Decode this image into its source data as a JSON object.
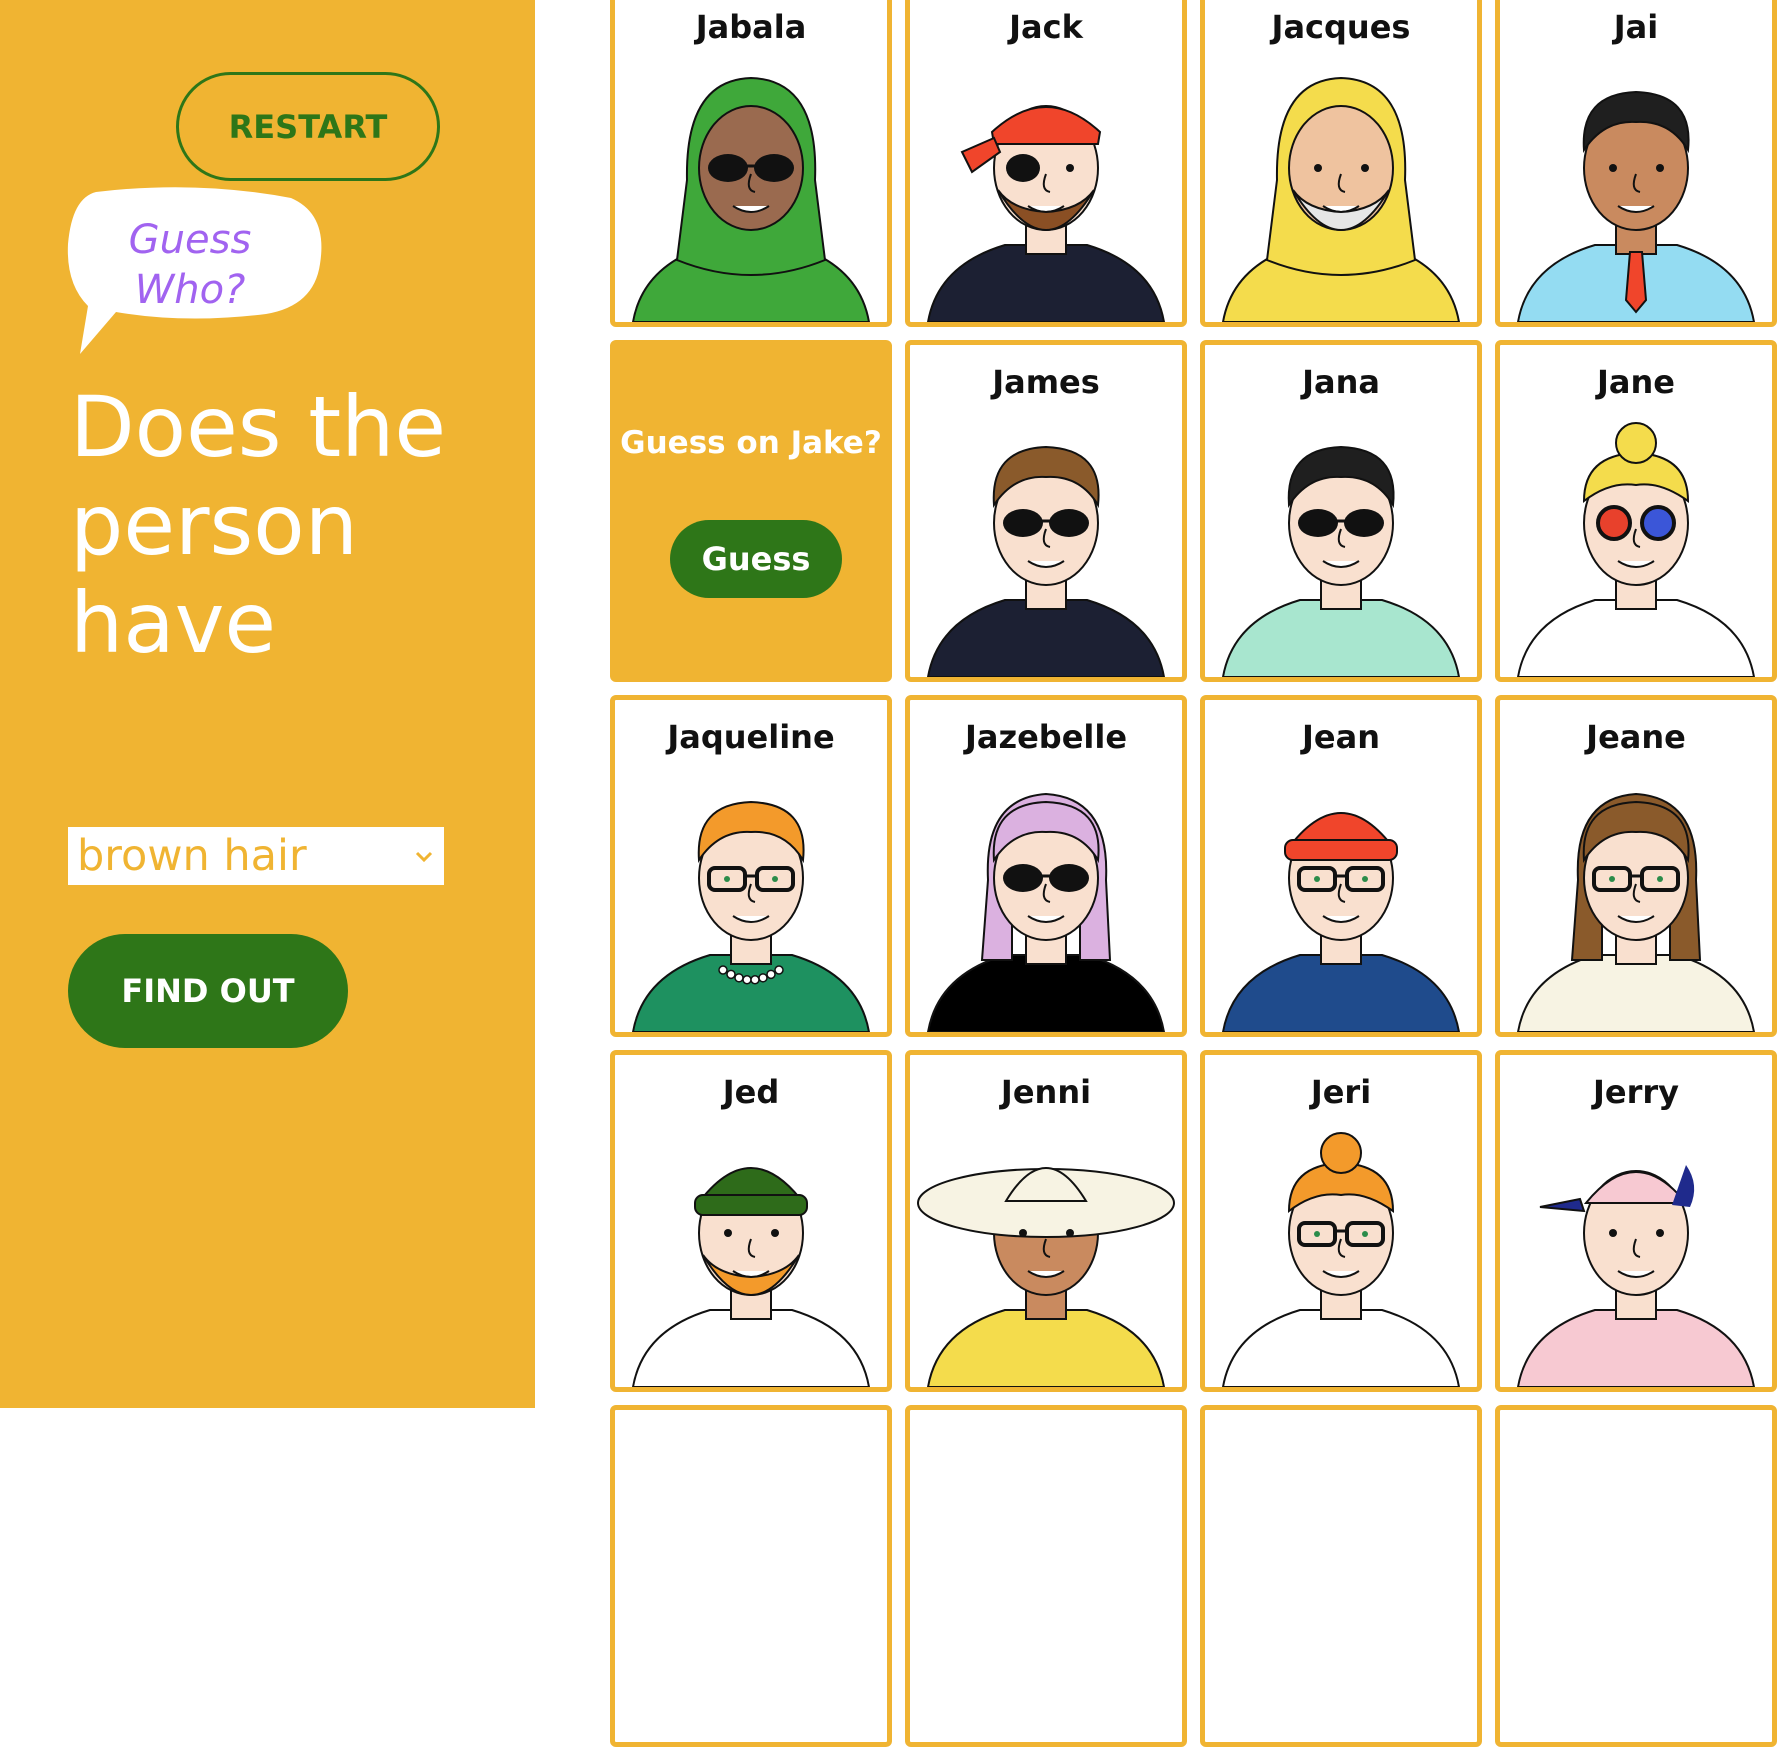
{
  "sidebar": {
    "restart_label": "RESTART",
    "logo_line1": "Guess",
    "logo_line2": "Who?",
    "question_text": "Does the person have",
    "attribute_selected": "brown hair",
    "find_out_label": "FIND OUT"
  },
  "board": {
    "guess_prompt": "Guess on Jake?",
    "guess_label": "Guess",
    "cards": [
      {
        "name": "Jabala",
        "skin": "#9a6a4f",
        "hair": "#3fa83a",
        "shirt": "#3fa83a",
        "accessory": "hijab-sunglasses"
      },
      {
        "name": "Jack",
        "skin": "#f9e0cf",
        "hair": "#f0452b",
        "shirt": "#1c2033",
        "accessory": "bandana-eyepatch"
      },
      {
        "name": "Jacques",
        "skin": "#efc39f",
        "hair": "#f4dc4c",
        "shirt": "#f4dc4c",
        "accessory": "raincoat-pipe"
      },
      {
        "name": "Jai",
        "skin": "#c98a5f",
        "hair": "#1f1f1f",
        "shirt": "#94dcf2",
        "accessory": "tie"
      },
      {
        "name": "Jake",
        "flipped": true
      },
      {
        "name": "James",
        "skin": "#f9e0cf",
        "hair": "#8a5a2b",
        "shirt": "#1c2033",
        "accessory": "sunglasses"
      },
      {
        "name": "Jana",
        "skin": "#f9e0cf",
        "hair": "#1f1f1f",
        "shirt": "#a8e6cf",
        "accessory": "sunglasses"
      },
      {
        "name": "Jane",
        "skin": "#f9e0cf",
        "hair": "#f4dc4c",
        "shirt": "#ffffff",
        "accessory": "3d-glasses"
      },
      {
        "name": "Jaqueline",
        "skin": "#f9e0cf",
        "hair": "#f39a2b",
        "shirt": "#1e9160",
        "accessory": "glasses-pearls"
      },
      {
        "name": "Jazebelle",
        "skin": "#f9e0cf",
        "hair": "#dbb1e0",
        "shirt": "#000000",
        "accessory": "round-shades"
      },
      {
        "name": "Jean",
        "skin": "#f9e0cf",
        "hair": "#f0452b",
        "shirt": "#1f4b8c",
        "accessory": "beanie-glasses"
      },
      {
        "name": "Jeane",
        "skin": "#f9e0cf",
        "hair": "#8a5a2b",
        "shirt": "#f7f3e3",
        "accessory": "glasses"
      },
      {
        "name": "Jed",
        "skin": "#f9e0cf",
        "hair": "#2e6b1a",
        "shirt": "#ffffff",
        "accessory": "beanie-beard"
      },
      {
        "name": "Jenni",
        "skin": "#c98a5f",
        "hair": "#f7f3e3",
        "shirt": "#f4dc4c",
        "accessory": "sunhat"
      },
      {
        "name": "Jeri",
        "skin": "#f9e0cf",
        "hair": "#f39a2b",
        "shirt": "#ffffff",
        "accessory": "round-glasses"
      },
      {
        "name": "Jerry",
        "skin": "#f9e0cf",
        "hair": "#f7c9d2",
        "shirt": "#f7c9d2",
        "accessory": "cap"
      }
    ]
  },
  "colors": {
    "panel": "#f0b432",
    "accent_green": "#2e7618",
    "logo_purple": "#a163f0"
  }
}
